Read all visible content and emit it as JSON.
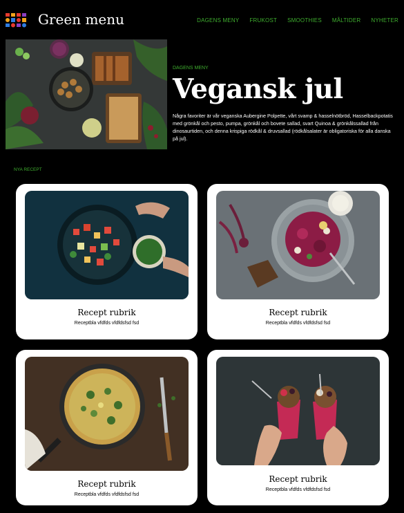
{
  "header": {
    "brand": "Green menu",
    "logo_icon": "colorful-grid-logo-icon",
    "nav": [
      "DAGENS MENY",
      "FRUKOST",
      "SMOOTHIES",
      "MÅLTIDER",
      "NYHETER"
    ]
  },
  "hero": {
    "kicker": "DAGENS MENY",
    "title": "Vegansk jul",
    "description": "Några favoriter är vår veganska Aubergine Polpette, vårt svamp & hasselnötbröd, Hasselbackpotatis med grönkål och pesto, pumpa, grönkål och bovete sallad, svart Quinoa & grönkålssallad från dinosaurtiden, och denna krispiga rödkål & druvsallad (rödkålsalater är obligatoriska för alla danska på jul)."
  },
  "section_label": "NYA RECEPT",
  "cards": [
    {
      "title": "Recept rubrik",
      "subtitle": "Receptbla vfdfds vfdfdsfsd fsd"
    },
    {
      "title": "Recept rubrik",
      "subtitle": "Receptbla vfdfds vfdfdsfsd fsd"
    },
    {
      "title": "Recept rubrik",
      "subtitle": "Receptbla vfdfds vfdfdsfsd fsd"
    },
    {
      "title": "Recept rubrik",
      "subtitle": "Receptbla vfdfds vfdfdsfsd fsd"
    }
  ],
  "colors": {
    "accent": "#3fae2f",
    "background": "#000000",
    "card": "#ffffff"
  }
}
